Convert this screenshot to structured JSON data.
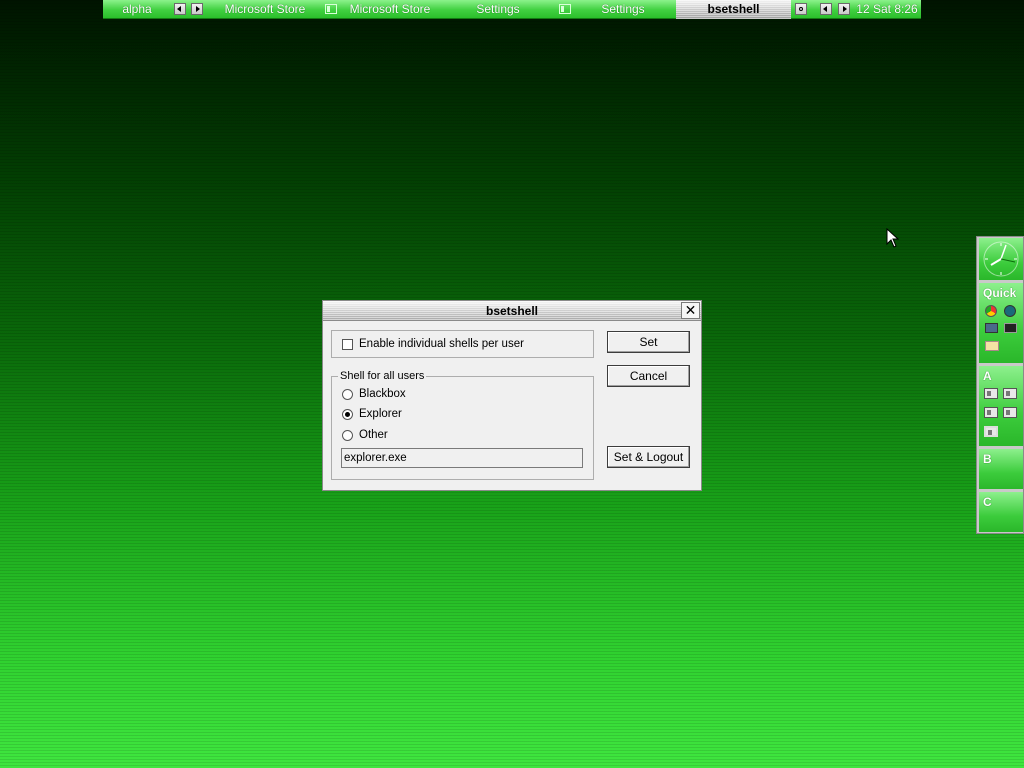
{
  "toolbar": {
    "workspace_name": "alpha",
    "tasks": [
      {
        "label": "Microsoft Store"
      },
      {
        "label": "Microsoft Store"
      },
      {
        "label": "Settings"
      },
      {
        "label": "Settings"
      },
      {
        "label": "bsetshell"
      }
    ],
    "clock": "12 Sat 8:26"
  },
  "slit": {
    "sections": [
      "Quick",
      "A",
      "B",
      "C"
    ]
  },
  "dialog": {
    "title": "bsetshell",
    "close_glyph": "✕",
    "individual_shells": {
      "label": "Enable individual shells per user",
      "checked": false
    },
    "shell_group": {
      "legend": "Shell for all users",
      "options": [
        {
          "label": "Blackbox",
          "selected": false
        },
        {
          "label": "Explorer",
          "selected": true
        },
        {
          "label": "Other",
          "selected": false
        }
      ],
      "command_value": "explorer.exe"
    },
    "buttons": {
      "set": "Set",
      "cancel": "Cancel",
      "set_logout": "Set & Logout"
    }
  },
  "colors": {
    "desktop_dark": "#001400",
    "desktop_light": "#3fe63f",
    "toolbar_green": "#41d041",
    "dialog_bg": "#f0f0f0"
  }
}
